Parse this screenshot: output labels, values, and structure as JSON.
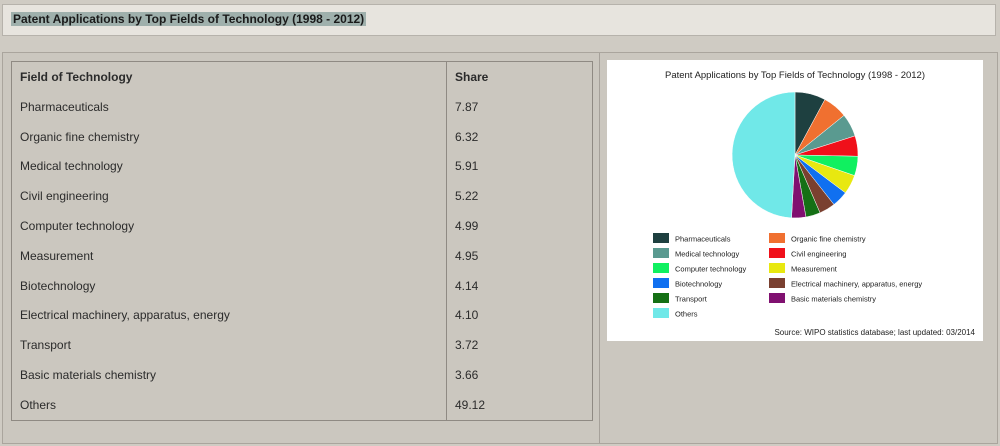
{
  "page_title": "Patent Applications by Top Fields of Technology (1998 - 2012)",
  "table": {
    "headers": [
      "Field of Technology",
      "Share"
    ],
    "rows": [
      [
        "Pharmaceuticals",
        "7.87"
      ],
      [
        "Organic fine chemistry",
        "6.32"
      ],
      [
        "Medical technology",
        "5.91"
      ],
      [
        "Civil engineering",
        "5.22"
      ],
      [
        "Computer technology",
        "4.99"
      ],
      [
        "Measurement",
        "4.95"
      ],
      [
        "Biotechnology",
        "4.14"
      ],
      [
        "Electrical machinery, apparatus, energy",
        "4.10"
      ],
      [
        "Transport",
        "3.72"
      ],
      [
        "Basic materials chemistry",
        "3.66"
      ],
      [
        "Others",
        "49.12"
      ]
    ]
  },
  "chart_data": {
    "type": "pie",
    "title": "Patent Applications by Top Fields of Technology (1998 - 2012)",
    "source": "Source: WIPO statistics database; last updated: 03/2014",
    "legend_position": "bottom",
    "categories": [
      "Pharmaceuticals",
      "Organic fine chemistry",
      "Medical technology",
      "Civil engineering",
      "Computer technology",
      "Measurement",
      "Biotechnology",
      "Electrical machinery, apparatus, energy",
      "Transport",
      "Basic materials chemistry",
      "Others"
    ],
    "values": [
      7.87,
      6.32,
      5.91,
      5.22,
      4.99,
      4.95,
      4.14,
      4.1,
      3.72,
      3.66,
      49.12
    ],
    "colors": [
      "#1e4040",
      "#f07030",
      "#5a9a90",
      "#f0101a",
      "#10f060",
      "#e8e810",
      "#1070f0",
      "#7a4030",
      "#157015",
      "#801070",
      "#70e8e8"
    ]
  }
}
